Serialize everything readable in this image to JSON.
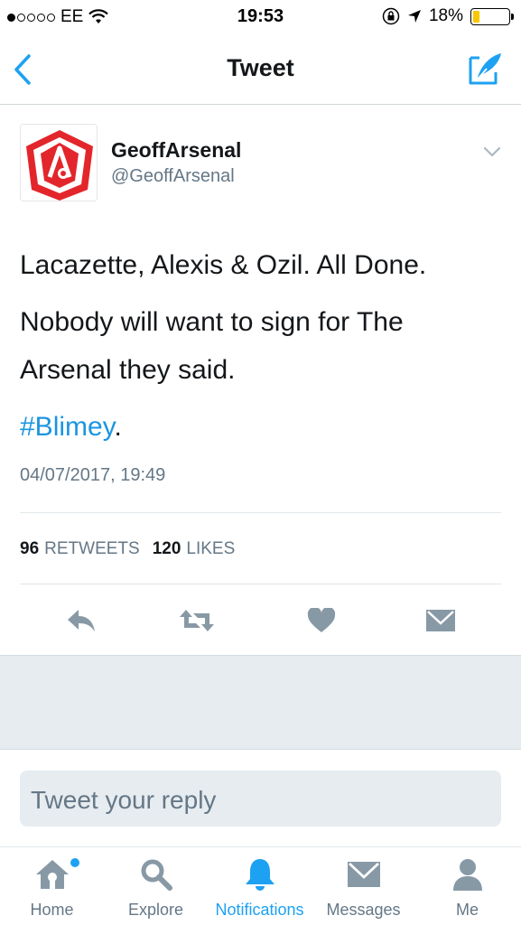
{
  "status_bar": {
    "carrier": "EE",
    "time": "19:53",
    "battery_percent": "18%",
    "battery_level": 0.18,
    "signal_bars": 1
  },
  "nav": {
    "title": "Tweet",
    "back_icon": "chevron-left-icon",
    "compose_icon": "compose-icon"
  },
  "tweet": {
    "display_name": "GeoffArsenal",
    "handle": "@GeoffArsenal",
    "text_line1": "Lacazette, Alexis & Ozil. All Done.",
    "text_line2": "Nobody will want to sign for The Arsenal they said.",
    "hashtag": "#Blimey",
    "hashtag_suffix": ".",
    "timestamp": "04/07/2017, 19:49",
    "retweets_count": "96",
    "retweets_label": "RETWEETS",
    "likes_count": "120",
    "likes_label": "LIKES"
  },
  "reply": {
    "placeholder": "Tweet your reply"
  },
  "tabs": [
    {
      "label": "Home",
      "icon": "home-icon",
      "has_notification_dot": true
    },
    {
      "label": "Explore",
      "icon": "search-icon"
    },
    {
      "label": "Notifications",
      "icon": "bell-icon",
      "active": true
    },
    {
      "label": "Messages",
      "icon": "envelope-icon"
    },
    {
      "label": "Me",
      "icon": "person-icon"
    }
  ],
  "colors": {
    "accent": "#1da1f2",
    "hashtag": "#1b95e0",
    "muted": "#657786",
    "icon_gray": "#8899a6",
    "battery": "#f7c702",
    "avatar_red": "#e3262b"
  }
}
